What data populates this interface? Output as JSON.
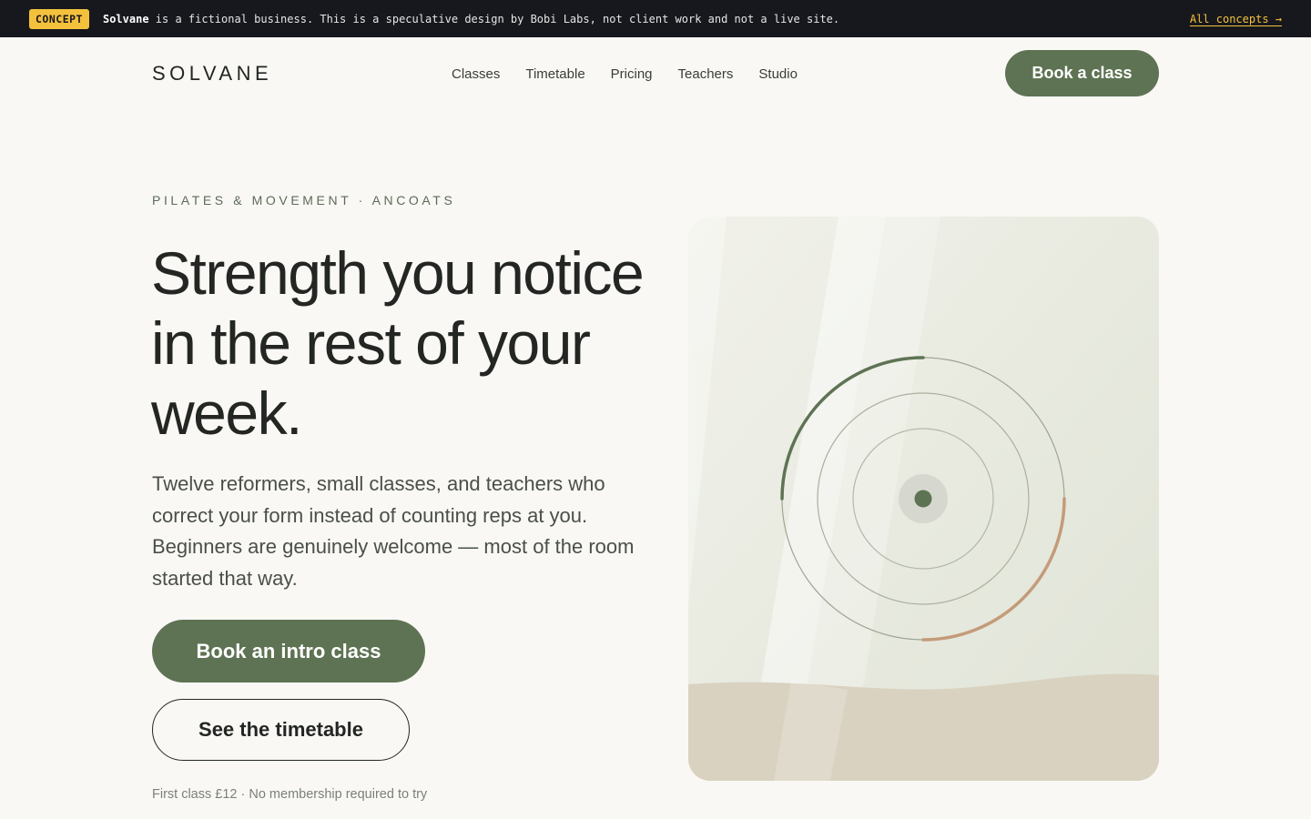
{
  "banner": {
    "badge": "CONCEPT",
    "brand": "Solvane",
    "message": " is a fictional business. This is a speculative design by Bobi Labs, not client work and not a live site.",
    "link": "All concepts →"
  },
  "header": {
    "logo": "SOLVANE",
    "nav": [
      "Classes",
      "Timetable",
      "Pricing",
      "Teachers",
      "Studio"
    ],
    "cta": "Book a class"
  },
  "hero": {
    "eyebrow": "PILATES & MOVEMENT · ANCOATS",
    "headline": "Strength you notice in the rest of your week.",
    "lede": "Twelve reformers, small classes, and teachers who correct your form instead of counting reps at you. Beginners are genuinely welcome — most of the room started that way.",
    "primary_cta": "Book an intro class",
    "secondary_cta": "See the timetable",
    "fineprint": "First class £12 · No membership required to try"
  },
  "illustration": {
    "icon": "concentric-rings-icon"
  },
  "colors": {
    "accent": "#5e7353",
    "warm": "#c49b7a",
    "badge": "#f4c13d",
    "banner_bg": "#17181d",
    "page_bg": "#f9f8f5"
  }
}
